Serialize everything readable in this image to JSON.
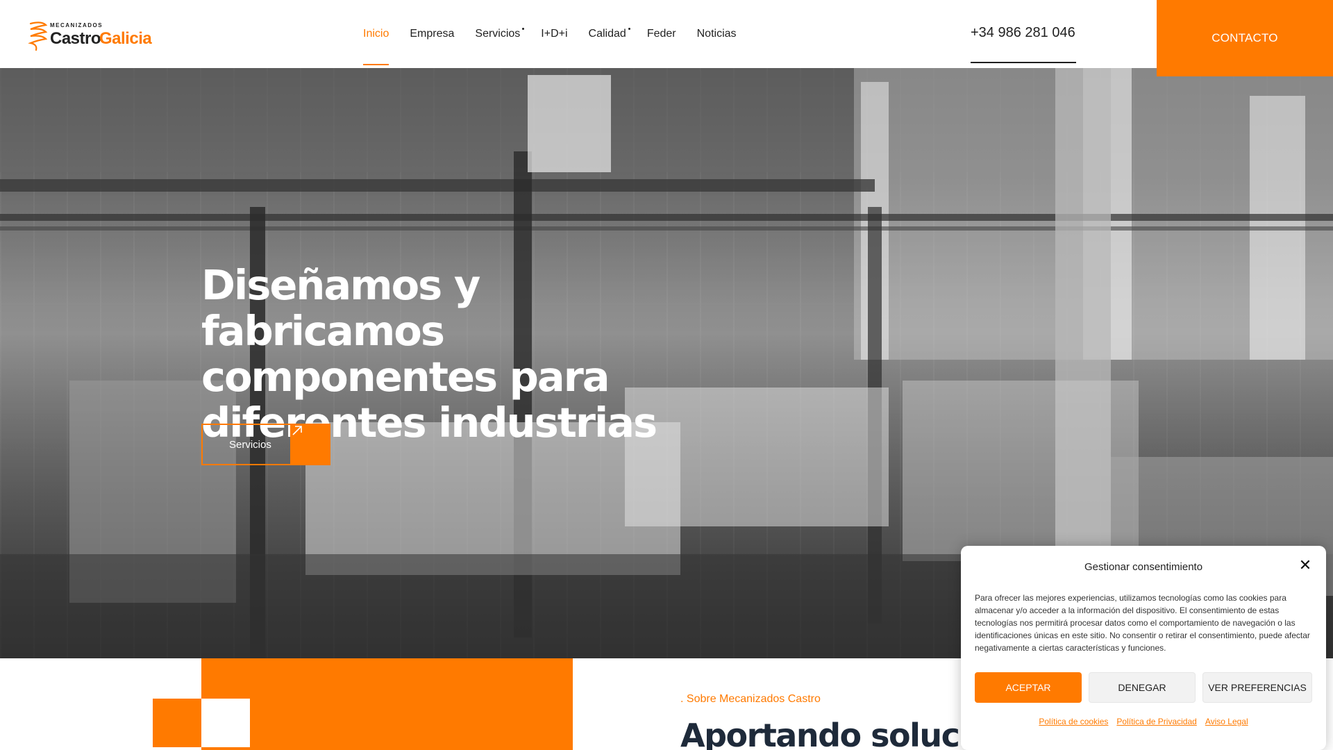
{
  "brand": {
    "top_text": "MECANIZADOS",
    "name_part1": "Castro",
    "name_part2": "Galicia",
    "accent_color": "#ff7a00"
  },
  "nav": {
    "items": [
      {
        "label": "Inicio",
        "active": true
      },
      {
        "label": "Empresa"
      },
      {
        "label": "Servicios",
        "has_submenu": true
      },
      {
        "label": "I+D+i"
      },
      {
        "label": "Calidad",
        "has_submenu": true
      },
      {
        "label": "Feder"
      },
      {
        "label": "Noticias"
      }
    ]
  },
  "header": {
    "phone": "+34 986 281 046",
    "contact_label": "CONTACTO"
  },
  "hero": {
    "title": "Diseñamos y fabricamos componentes para diferentes industrias",
    "button_label": "Servicios",
    "button_icon": "arrow-up-right-icon"
  },
  "about": {
    "eyebrow": ". Sobre Mecanizados Castro",
    "title": "Aportando soluciones de"
  },
  "cookie": {
    "title": "Gestionar consentimiento",
    "text": "Para ofrecer las mejores experiencias, utilizamos tecnologías como las cookies para almacenar y/o acceder a la información del dispositivo. El consentimiento de estas tecnologías nos permitirá procesar datos como el comportamiento de navegación o las identificaciones únicas en este sitio. No consentir o retirar el consentimiento, puede afectar negativamente a ciertas características y funciones.",
    "accept_label": "ACEPTAR",
    "deny_label": "DENEGAR",
    "prefs_label": "VER PREFERENCIAS",
    "links": [
      "Política de cookies",
      "Política de Privacidad",
      "Aviso Legal"
    ]
  }
}
